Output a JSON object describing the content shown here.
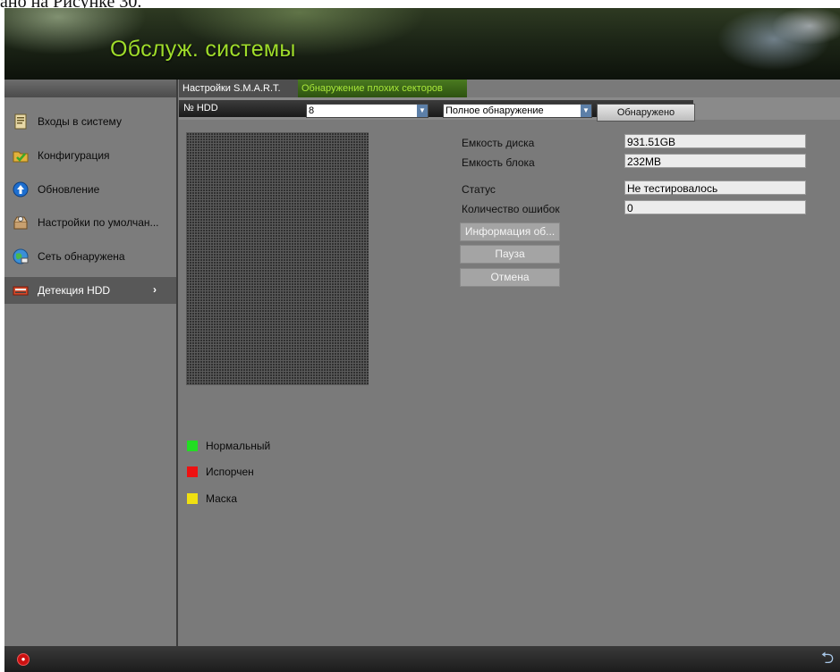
{
  "top_crop_text": "ано на Рисунке 30.",
  "header": {
    "title": "Обслуж. системы"
  },
  "sidebar": {
    "items": [
      {
        "label": "Входы в систему",
        "icon": "log-book-icon"
      },
      {
        "label": "Конфигурация",
        "icon": "folder-check-icon"
      },
      {
        "label": "Обновление",
        "icon": "upgrade-arrow-icon"
      },
      {
        "label": "Настройки по умолчан...",
        "icon": "restore-box-icon"
      },
      {
        "label": "Сеть обнаружена",
        "icon": "network-globe-icon"
      },
      {
        "label": "Детекция HDD",
        "icon": "hdd-icon",
        "chevron": "›"
      }
    ],
    "active_index": 5
  },
  "tabs": [
    {
      "label": "Настройки S.M.A.R.T."
    },
    {
      "label": "Обнаружение плохих секторов"
    }
  ],
  "toolbar": {
    "hdd_label": "№ HDD",
    "hdd_value": "8",
    "mode_value": "Полное обнаружение",
    "detect_label": "Обнаружено"
  },
  "info": {
    "capacity_label": "Емкость диска",
    "capacity_value": "931.51GB",
    "block_label": "Емкость блока",
    "block_value": "232MB",
    "status_label": "Статус",
    "status_value": "Не тестировалось",
    "errors_label": "Количество ошибок",
    "errors_value": "0"
  },
  "actions": {
    "info_label": "Информация об...",
    "pause_label": "Пауза",
    "cancel_label": "Отмена"
  },
  "legend": [
    {
      "label": "Нормальный",
      "color": "#22dd22"
    },
    {
      "label": "Испорчен",
      "color": "#ee1111"
    },
    {
      "label": "Маска",
      "color": "#f0e011"
    }
  ],
  "footer": {
    "back_glyph": "⮌"
  }
}
